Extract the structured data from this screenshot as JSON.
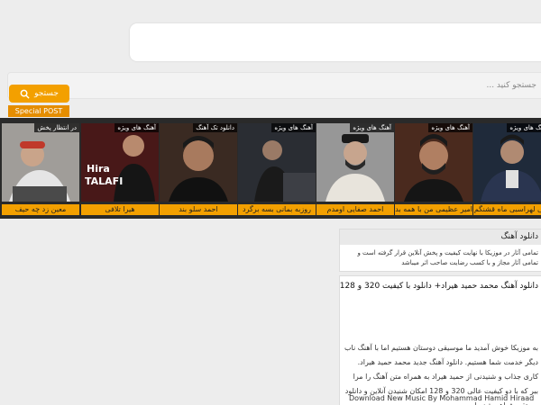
{
  "search": {
    "placeholder": "جستجو کنید ...",
    "button_label": "جستجو"
  },
  "special_tab": {
    "label": "Special POST"
  },
  "slider": {
    "cards": [
      {
        "badge": "در انتظار پخش",
        "title": "معین زد چه حیف",
        "bg": "#8a8a8a"
      },
      {
        "badge": "آهنگ های ویژه",
        "title": "هیرا تلافی",
        "bg": "#5c1f1f",
        "overlay_text": "Hira TALAFI"
      },
      {
        "badge": "دانلود تک آهنگ",
        "title": "احمد سلو بند",
        "bg": "#3a2a22"
      },
      {
        "badge": "آهنگ های ویژه",
        "title": "روزبه بمانی بسه برگرد",
        "bg": "#2a2d33"
      },
      {
        "badge": "آهنگ های ویژه",
        "title": "احمد صفایی اومدم",
        "bg": "#7a7a7a"
      },
      {
        "badge": "آهنگ های ویژه",
        "title": "امیر عظیمی من با همه بدم",
        "bg": "#4a2a1e"
      },
      {
        "badge": "آهنگ های ویژه",
        "title": "علی لهراسبی ماه قشنگم",
        "bg": "#1f2a3a"
      }
    ]
  },
  "download_panel": {
    "title": "دانلود آهنگ",
    "text": "تمامی آثار در موزیکا با نهایت کیفیت و پخش آنلاین قرار گرفته است و تمامی آثار مجاز و با کسب رضایت صاحب اثر میباشد"
  },
  "article": {
    "title": "دانلود آهنگ محمد حمید هیراد+ دانلود با کیفیت 320 و 128",
    "text": "به موزیکا خوش آمدید ما موسیقی دوستان هستیم اما با آهنگ ناب دیگر خدمت شما هستیم. دانلود آهنگ جدید محمد حمید هیراد. کاری جذاب و شنیدنی از حمید هیراد به همراه متن آهنگ را مرا ببر که با دو کیفیت عالی 320 و 128 امکان شنیدن آنلاین و دانلود مستقیم فراهم شده است.",
    "english": "Download New Music By Mohammad Hamid Hiraad"
  },
  "colors": {
    "accent": "#f3a000",
    "tab": "#e58d00",
    "strip": "#2a2a2a"
  }
}
